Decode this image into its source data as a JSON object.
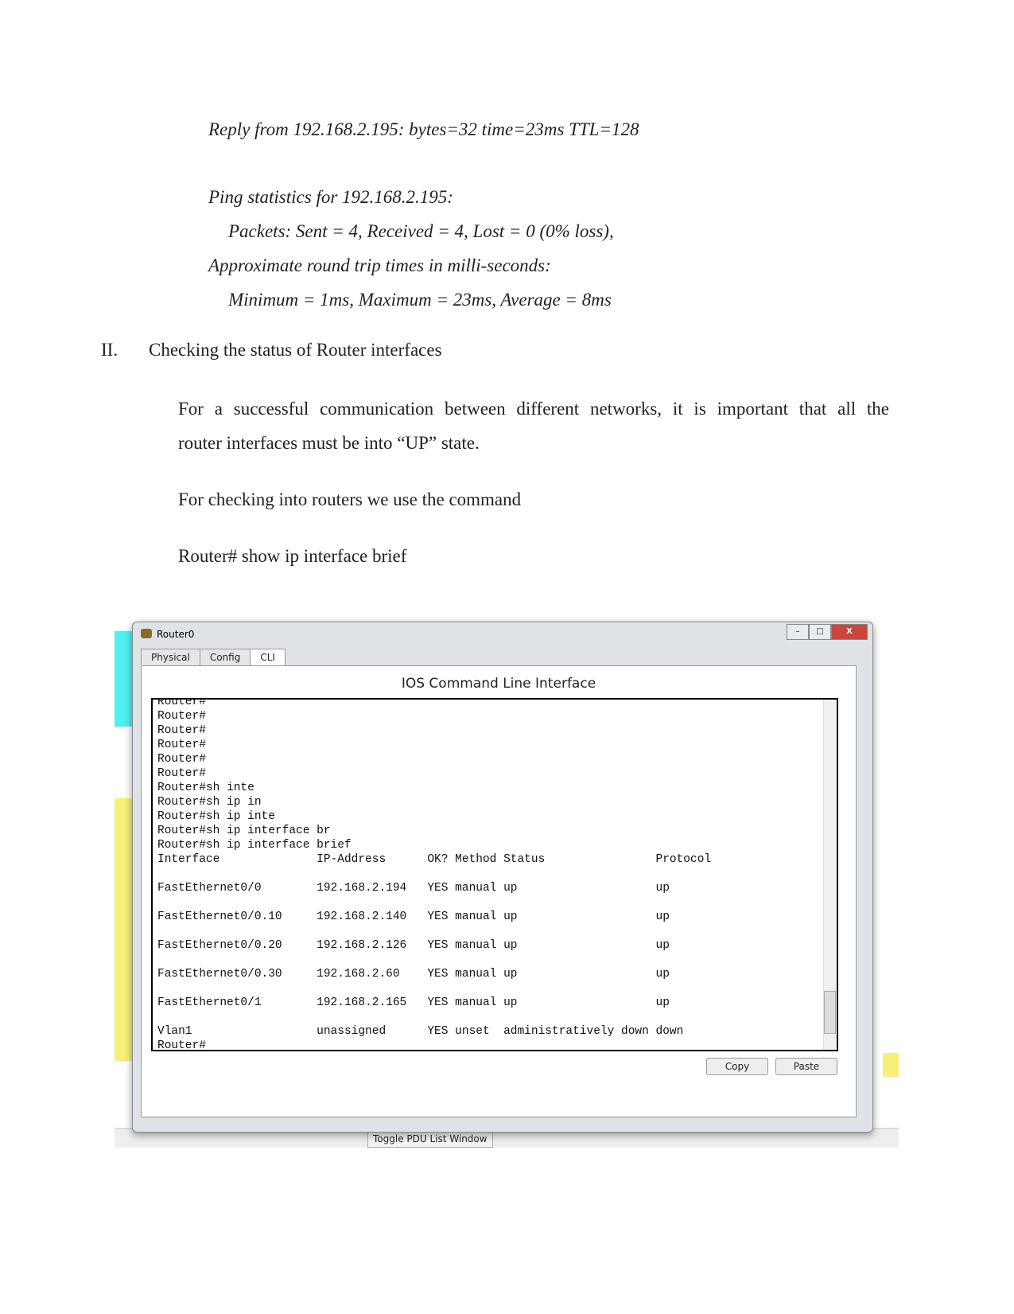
{
  "ping": {
    "reply": "Reply from 192.168.2.195: bytes=32 time=23ms TTL=128",
    "stats": "Ping statistics for 192.168.2.195:",
    "packets": "Packets: Sent = 4, Received = 4, Lost = 0 (0% loss),",
    "approx": "Approximate round trip times in milli-seconds:",
    "times": "Minimum = 1ms, Maximum = 23ms, Average = 8ms"
  },
  "section": {
    "num": "II.",
    "title": "Checking the status of Router interfaces"
  },
  "para1a": "For a successful communication between different networks, it is important that all the",
  "para1b": "router interfaces must be into “UP” state.",
  "para2": "For checking into routers we use the command",
  "command": "Router# show ip interface brief",
  "window": {
    "title": "Router0",
    "tabs": [
      "Physical",
      "Config",
      "CLI"
    ],
    "active_tab": "CLI",
    "panel_title": "IOS Command Line Interface",
    "copy": "Copy",
    "paste": "Paste",
    "min": "–",
    "max": "□",
    "close": "X"
  },
  "cli_output": "Router#\nRouter#\nRouter#\nRouter#\nRouter#\nRouter#\nRouter#sh inte\nRouter#sh ip in\nRouter#sh ip inte\nRouter#sh ip interface br\nRouter#sh ip interface brief\nInterface              IP-Address      OK? Method Status                Protocol\n\nFastEthernet0/0        192.168.2.194   YES manual up                    up\n\nFastEthernet0/0.10     192.168.2.140   YES manual up                    up\n\nFastEthernet0/0.20     192.168.2.126   YES manual up                    up\n\nFastEthernet0/0.30     192.168.2.60    YES manual up                    up\n\nFastEthernet0/1        192.168.2.165   YES manual up                    up\n\nVlan1                  unassigned      YES unset  administratively down down\nRouter#",
  "background": {
    "pdu_button": "Toggle PDU List Window"
  }
}
